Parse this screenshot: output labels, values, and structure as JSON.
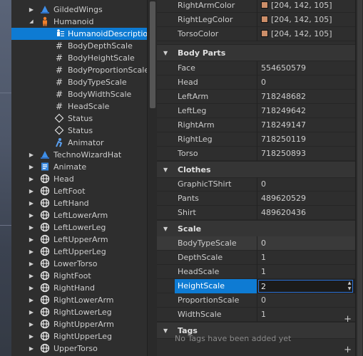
{
  "explorer": {
    "items": [
      {
        "label": "GildedWings",
        "icon": "accessory-icon",
        "arrow": "right",
        "level": 1,
        "selected": false
      },
      {
        "label": "Humanoid",
        "icon": "humanoid-icon",
        "arrow": "down",
        "level": 1,
        "selected": false
      },
      {
        "label": "HumanoidDescription",
        "icon": "humanoid-description-icon",
        "arrow": "",
        "level": 2,
        "selected": true
      },
      {
        "label": "BodyDepthScale",
        "icon": "number-value-icon",
        "arrow": "",
        "level": 2,
        "selected": false
      },
      {
        "label": "BodyHeightScale",
        "icon": "number-value-icon",
        "arrow": "",
        "level": 2,
        "selected": false
      },
      {
        "label": "BodyProportionScale",
        "icon": "number-value-icon",
        "arrow": "",
        "level": 2,
        "selected": false
      },
      {
        "label": "BodyTypeScale",
        "icon": "number-value-icon",
        "arrow": "",
        "level": 2,
        "selected": false
      },
      {
        "label": "BodyWidthScale",
        "icon": "number-value-icon",
        "arrow": "",
        "level": 2,
        "selected": false
      },
      {
        "label": "HeadScale",
        "icon": "number-value-icon",
        "arrow": "",
        "level": 2,
        "selected": false
      },
      {
        "label": "Status",
        "icon": "value-diamond-icon",
        "arrow": "",
        "level": 2,
        "selected": false
      },
      {
        "label": "Status",
        "icon": "value-diamond-icon",
        "arrow": "",
        "level": 2,
        "selected": false
      },
      {
        "label": "Animator",
        "icon": "animator-icon",
        "arrow": "",
        "level": 2,
        "selected": false
      },
      {
        "label": "TechnoWizardHat",
        "icon": "accessory-icon",
        "arrow": "right",
        "level": 1,
        "selected": false
      },
      {
        "label": "Animate",
        "icon": "script-icon",
        "arrow": "right",
        "level": 1,
        "selected": false
      },
      {
        "label": "Head",
        "icon": "part-icon",
        "arrow": "right",
        "level": 1,
        "selected": false
      },
      {
        "label": "LeftFoot",
        "icon": "part-icon",
        "arrow": "right",
        "level": 1,
        "selected": false
      },
      {
        "label": "LeftHand",
        "icon": "part-icon",
        "arrow": "right",
        "level": 1,
        "selected": false
      },
      {
        "label": "LeftLowerArm",
        "icon": "part-icon",
        "arrow": "right",
        "level": 1,
        "selected": false
      },
      {
        "label": "LeftLowerLeg",
        "icon": "part-icon",
        "arrow": "right",
        "level": 1,
        "selected": false
      },
      {
        "label": "LeftUpperArm",
        "icon": "part-icon",
        "arrow": "right",
        "level": 1,
        "selected": false
      },
      {
        "label": "LeftUpperLeg",
        "icon": "part-icon",
        "arrow": "right",
        "level": 1,
        "selected": false
      },
      {
        "label": "LowerTorso",
        "icon": "part-icon",
        "arrow": "right",
        "level": 1,
        "selected": false
      },
      {
        "label": "RightFoot",
        "icon": "part-icon",
        "arrow": "right",
        "level": 1,
        "selected": false
      },
      {
        "label": "RightHand",
        "icon": "part-icon",
        "arrow": "right",
        "level": 1,
        "selected": false
      },
      {
        "label": "RightLowerArm",
        "icon": "part-icon",
        "arrow": "right",
        "level": 1,
        "selected": false
      },
      {
        "label": "RightLowerLeg",
        "icon": "part-icon",
        "arrow": "right",
        "level": 1,
        "selected": false
      },
      {
        "label": "RightUpperArm",
        "icon": "part-icon",
        "arrow": "right",
        "level": 1,
        "selected": false
      },
      {
        "label": "RightUpperLeg",
        "icon": "part-icon",
        "arrow": "right",
        "level": 1,
        "selected": false
      },
      {
        "label": "UpperTorso",
        "icon": "part-icon",
        "arrow": "right",
        "level": 1,
        "selected": false
      }
    ]
  },
  "properties": {
    "colors": {
      "swatch": "#cc8e69",
      "selection": "#0e7bd3"
    },
    "color_rows": [
      {
        "name": "RightArmColor",
        "value": "[204, 142, 105]"
      },
      {
        "name": "RightLegColor",
        "value": "[204, 142, 105]"
      },
      {
        "name": "TorsoColor",
        "value": "[204, 142, 105]"
      }
    ],
    "body_parts": {
      "title": "Body Parts",
      "rows": [
        {
          "name": "Face",
          "value": "554650579"
        },
        {
          "name": "Head",
          "value": "0"
        },
        {
          "name": "LeftArm",
          "value": "718248682"
        },
        {
          "name": "LeftLeg",
          "value": "718249642"
        },
        {
          "name": "RightArm",
          "value": "718249147"
        },
        {
          "name": "RightLeg",
          "value": "718250119"
        },
        {
          "name": "Torso",
          "value": "718250893"
        }
      ]
    },
    "clothes": {
      "title": "Clothes",
      "rows": [
        {
          "name": "GraphicTShirt",
          "value": "0"
        },
        {
          "name": "Pants",
          "value": "489620529"
        },
        {
          "name": "Shirt",
          "value": "489620436"
        }
      ]
    },
    "scale": {
      "title": "Scale",
      "rows": [
        {
          "name": "BodyTypeScale",
          "value": "0",
          "state": "hover"
        },
        {
          "name": "DepthScale",
          "value": "1",
          "state": ""
        },
        {
          "name": "HeadScale",
          "value": "1",
          "state": ""
        },
        {
          "name": "HeightScale",
          "value": "2",
          "state": "editing"
        },
        {
          "name": "ProportionScale",
          "value": "0",
          "state": ""
        },
        {
          "name": "WidthScale",
          "value": "1",
          "state": ""
        }
      ]
    },
    "tags": {
      "title": "Tags",
      "empty_text": "No Tags have been added yet"
    },
    "plus_symbol": "+"
  }
}
